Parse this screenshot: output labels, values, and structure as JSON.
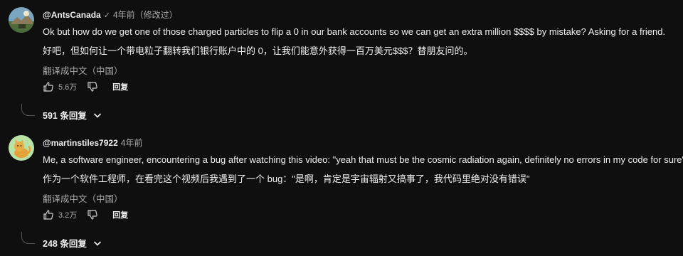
{
  "comments": [
    {
      "handle": "@AntsCanada",
      "verified_icon": "check-icon",
      "time": "4年前（修改过）",
      "text_en": "Ok but how do we get one of those charged particles to flip a 0 in our bank accounts so we can get an extra million $$$$ by mistake? Asking for a friend.",
      "text_zh": "好吧，但如何让一个带电粒子翻转我们银行账户中的 0，让我们能意外获得一百万美元$$$？替朋友问的。",
      "translate_label": "翻译成中文（中国）",
      "likes": "5.6万",
      "reply_label": "回复",
      "replies_label": "591 条回复"
    },
    {
      "handle": "@martinstiles7922",
      "time": "4年前",
      "text_en": "Me, a software engineer, encountering a bug after watching this video: \"yeah that must be the cosmic radiation again, definitely no errors in my code for sure\"",
      "text_zh": "作为一个软件工程师，在看完这个视频后我遇到了一个 bug：\"是啊，肯定是宇宙辐射又搞事了，我代码里绝对没有错误\"",
      "translate_label": "翻译成中文（中国）",
      "likes": "3.2万",
      "reply_label": "回复",
      "replies_label": "248 条回复"
    }
  ],
  "colors": {
    "background": "#0f0f0f",
    "text_primary": "#f1f1f1",
    "text_secondary": "#aaaaaa"
  }
}
